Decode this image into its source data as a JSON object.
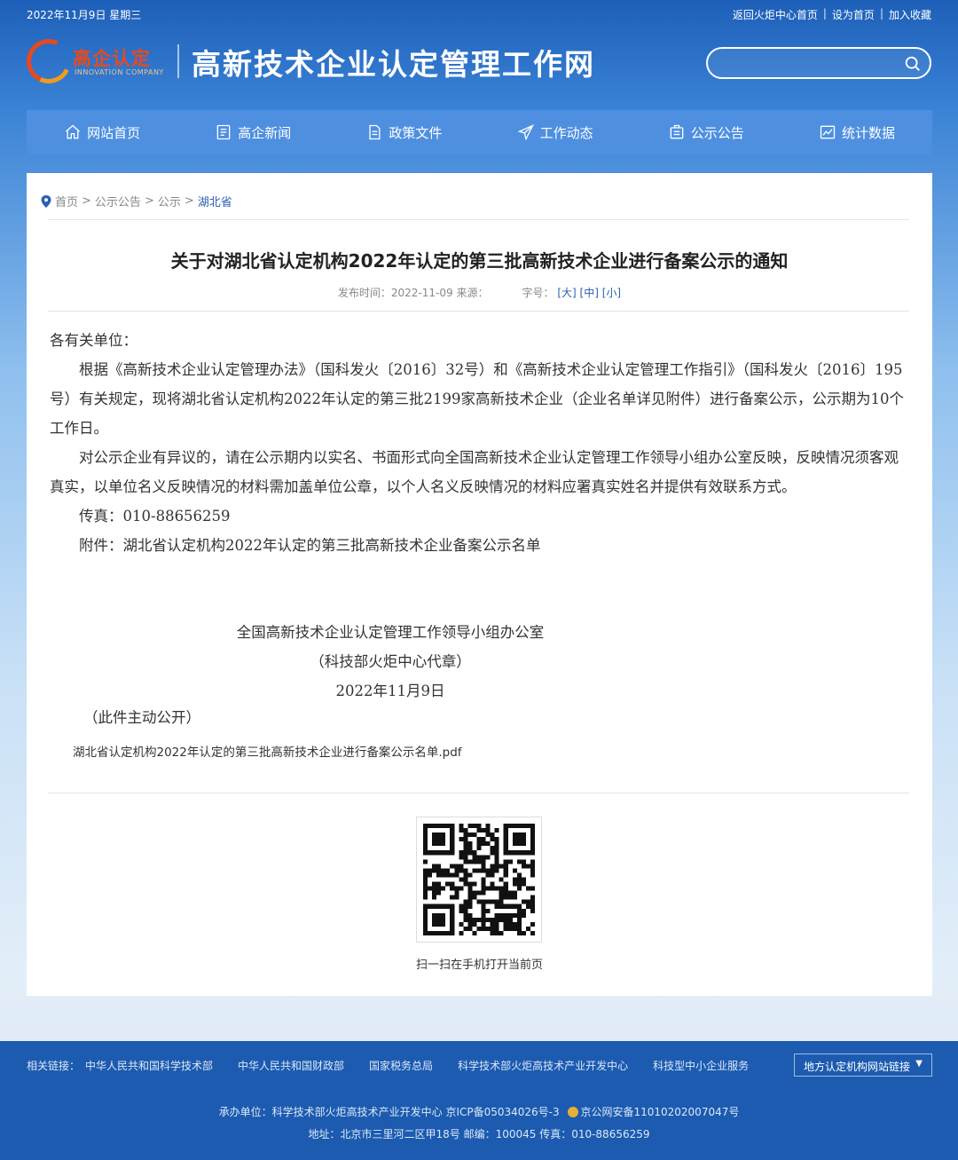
{
  "topbar": {
    "date": "2022年11月9日 星期三",
    "link1": "返回火炬中心首页",
    "link2": "设为首页",
    "link3": "加入收藏",
    "sep": "|"
  },
  "header": {
    "logo_cn": "高企认定",
    "logo_en": "INNOVATION COMPANY",
    "site_title": "高新技术企业认定管理工作网",
    "search_placeholder": ""
  },
  "nav": {
    "items": [
      {
        "label": "网站首页",
        "icon": "home-icon"
      },
      {
        "label": "高企新闻",
        "icon": "news-icon"
      },
      {
        "label": "政策文件",
        "icon": "document-icon"
      },
      {
        "label": "工作动态",
        "icon": "send-icon"
      },
      {
        "label": "公示公告",
        "icon": "notice-icon"
      },
      {
        "label": "统计数据",
        "icon": "stats-icon"
      }
    ]
  },
  "breadcrumb": {
    "items": [
      "首页",
      "公示公告",
      "公示",
      "湖北省"
    ],
    "sep": ">"
  },
  "article": {
    "title": "关于对湖北省认定机构2022年认定的第三批高新技术企业进行备案公示的通知",
    "publish_label": "发布时间：2022-11-09 来源：",
    "font_label": "字号：",
    "font_large": "[大]",
    "font_medium": "[中]",
    "font_small": "[小]",
    "salutation": "各有关单位：",
    "para1": "根据《高新技术企业认定管理办法》（国科发火〔2016〕32号）和《高新技术企业认定管理工作指引》（国科发火〔2016〕195号）有关规定，现将湖北省认定机构2022年认定的第三批2199家高新技术企业（企业名单详见附件）进行备案公示，公示期为10个工作日。",
    "para2": "对公示企业有异议的，请在公示期内以实名、书面形式向全国高新技术企业认定管理工作领导小组办公室反映，反映情况须客观真实，以单位名义反映情况的材料需加盖单位公章，以个人名义反映情况的材料应署真实姓名并提供有效联系方式。",
    "fax": "传真：010-88656259",
    "attachment": "附件：湖北省认定机构2022年认定的第三批高新技术企业备案公示名单",
    "sig_org": "全国高新技术企业认定管理工作领导小组办公室",
    "sig_proxy": "（科技部火炬中心代章）",
    "sig_date": "2022年11月9日",
    "public_note": "（此件主动公开）",
    "pdf_link": "湖北省认定机构2022年认定的第三批高新技术企业进行备案公示名单.pdf",
    "qr_caption": "扫一扫在手机打开当前页"
  },
  "footer": {
    "links_label": "相关链接：",
    "links": [
      "中华人民共和国科学技术部",
      "中华人民共和国财政部",
      "国家税务总局",
      "科学技术部火炬高技术产业开发中心",
      "科技型中小企业服务"
    ],
    "select_label": "地方认定机构网站链接",
    "line1_a": "承办单位：科学技术部火炬高技术产业开发中心 京ICP备05034026号-3",
    "line1_b": "京公网安备11010202007047号",
    "line2": "地址：北京市三里河二区甲18号 邮编：100045 传真：010-88656259"
  },
  "colors": {
    "nav_bg": "#4e8fe0",
    "footer_bg": "#1c5bb0",
    "link_blue": "#2b5fb0",
    "logo_red": "#e8491d"
  }
}
